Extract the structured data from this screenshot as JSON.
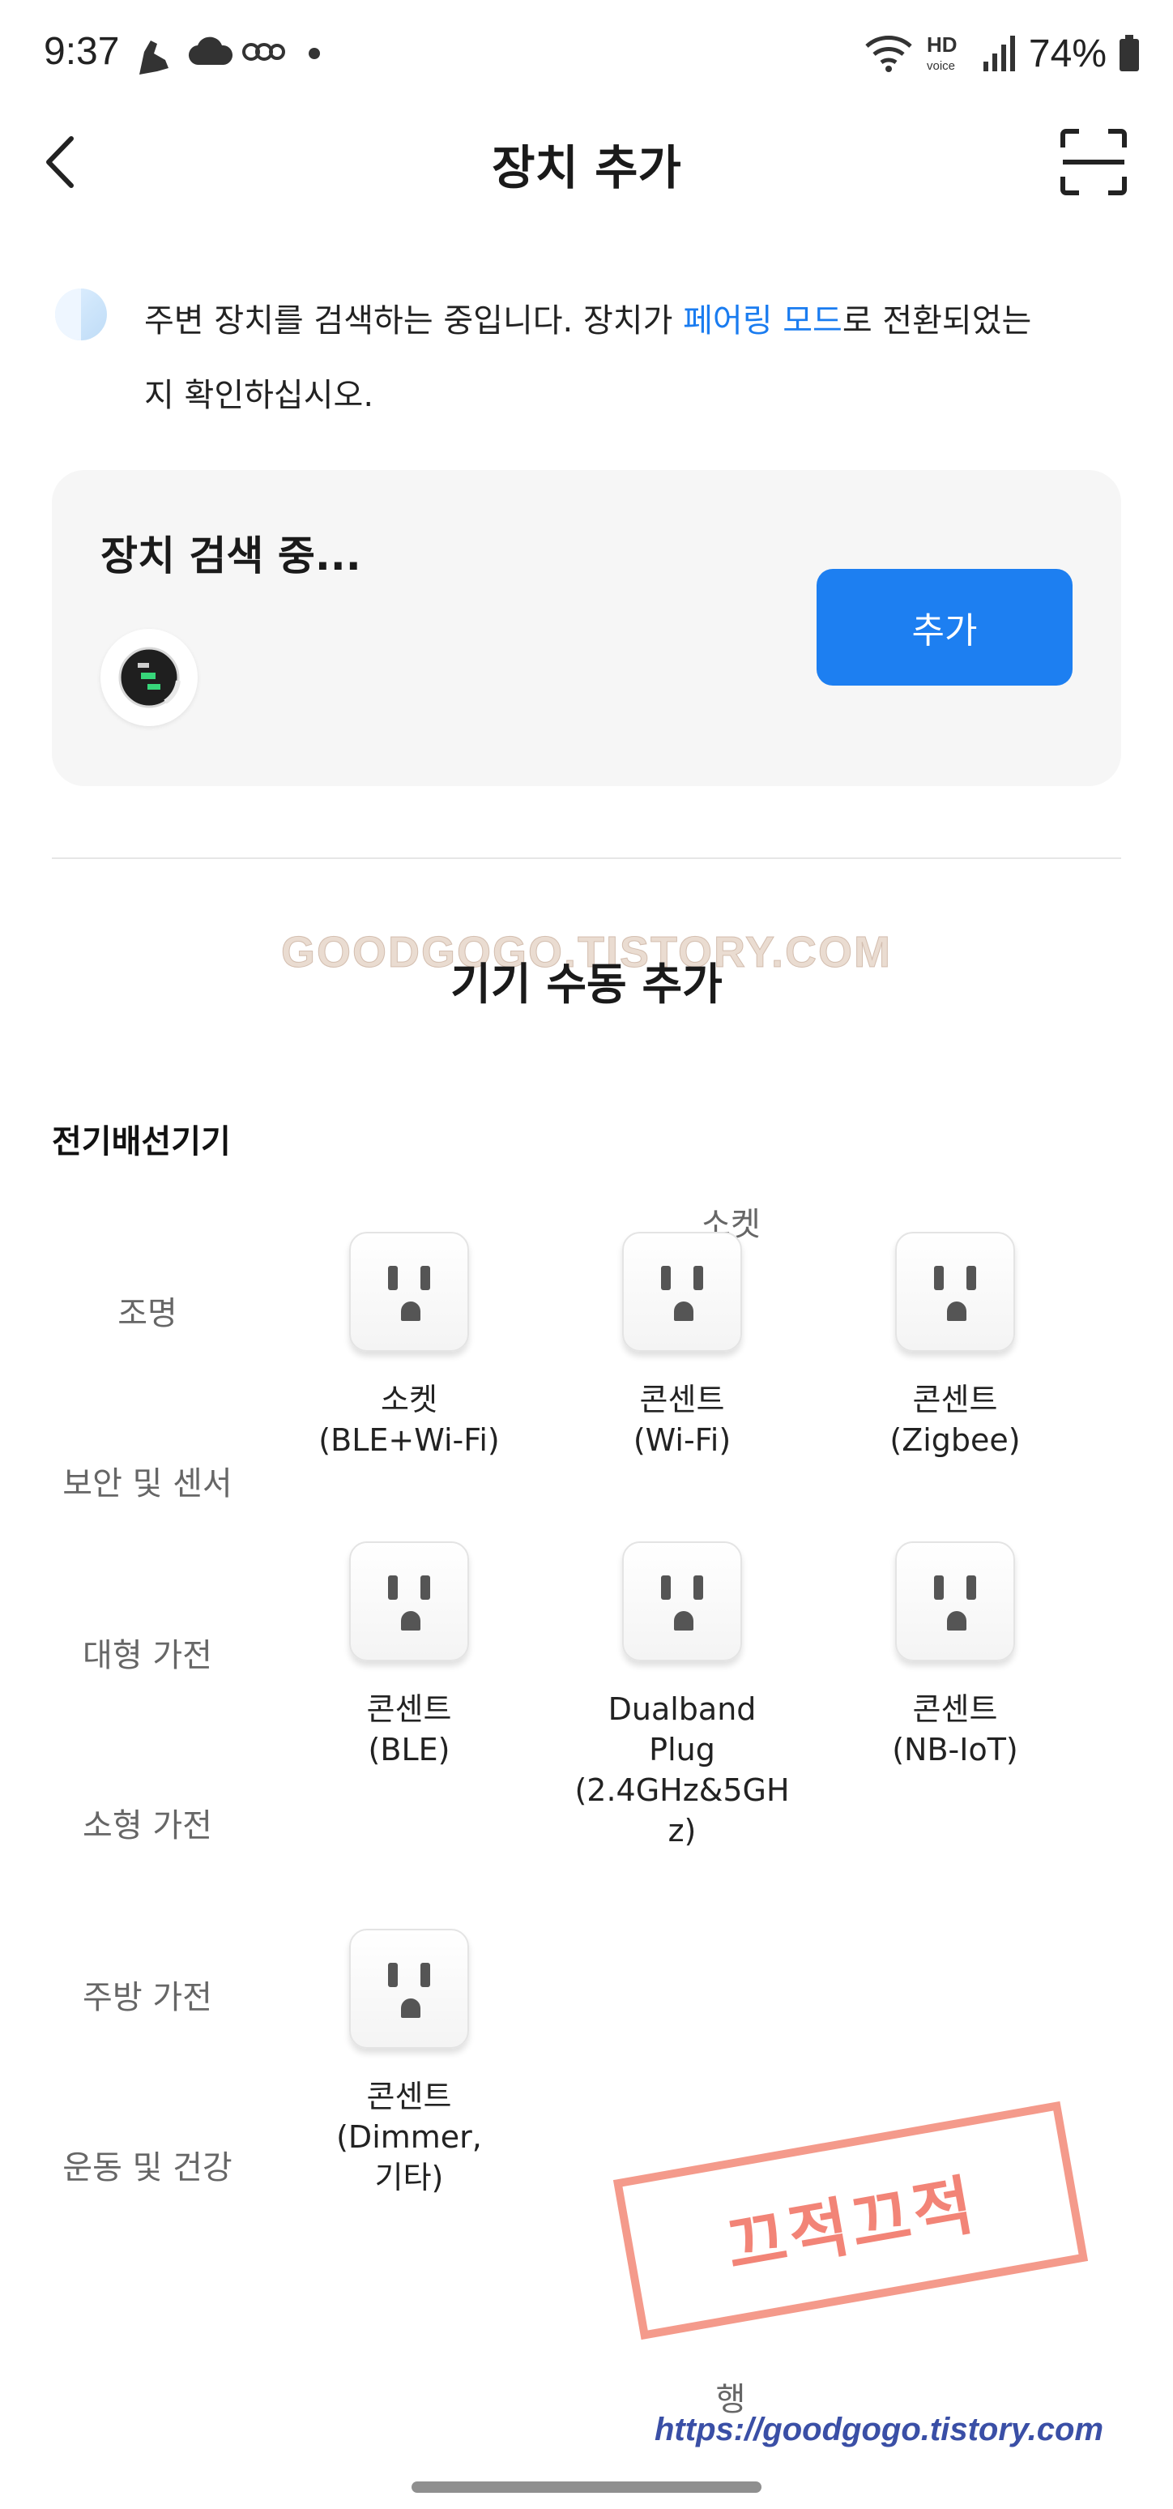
{
  "status_bar": {
    "time": "9:37",
    "battery": "74%",
    "network": "HD voice",
    "icons": [
      "shoe-icon",
      "cloud-icon",
      "app-badge-icon",
      "dot-icon",
      "wifi-icon",
      "hd-voice-icon",
      "signal-icon",
      "battery-icon"
    ]
  },
  "header": {
    "title": "장치 추가",
    "back_icon": "chevron-left-icon",
    "scan_icon": "scan-icon"
  },
  "notice": {
    "text_before": "주변 장치를 검색하는 중입니다. 장치가 ",
    "link": "페어링 모드",
    "text_after": "로 전환되었는지 확인하십시오."
  },
  "search_card": {
    "title": "장치 검색 중...",
    "add_button": "추가"
  },
  "watermark_top": "GOODGOGO.TISTORY.COM",
  "manual_section_title": "기기 수동 추가",
  "categories": [
    {
      "label": "전기배선기기",
      "active": true
    },
    {
      "label": "조명",
      "active": false
    },
    {
      "label": "보안 및 센서",
      "active": false
    },
    {
      "label": "대형 가전",
      "active": false
    },
    {
      "label": "소형 가전",
      "active": false
    },
    {
      "label": "주방 가전",
      "active": false
    },
    {
      "label": "운동 및 건강",
      "active": false
    }
  ],
  "sub_header": "소켓",
  "devices": [
    {
      "label": "소켓\n(BLE+Wi-Fi)"
    },
    {
      "label": "콘센트\n(Wi-Fi)"
    },
    {
      "label": "콘센트\n(Zigbee)"
    },
    {
      "label": "콘센트\n(BLE)"
    },
    {
      "label": "Dualband\nPlug\n(2.4GHz&5GH\nz)"
    },
    {
      "label": "콘센트\n(NB-IoT)"
    },
    {
      "label": "콘센트\n(Dimmer,\n기타)"
    }
  ],
  "next_section_partial": "행",
  "stamp": "끄적끄적",
  "url_watermark": "https://goodgogo.tistory.com",
  "colors": {
    "accent": "#1d7ff1",
    "link": "#1a7cf0",
    "card_bg": "#f6f6f6"
  }
}
